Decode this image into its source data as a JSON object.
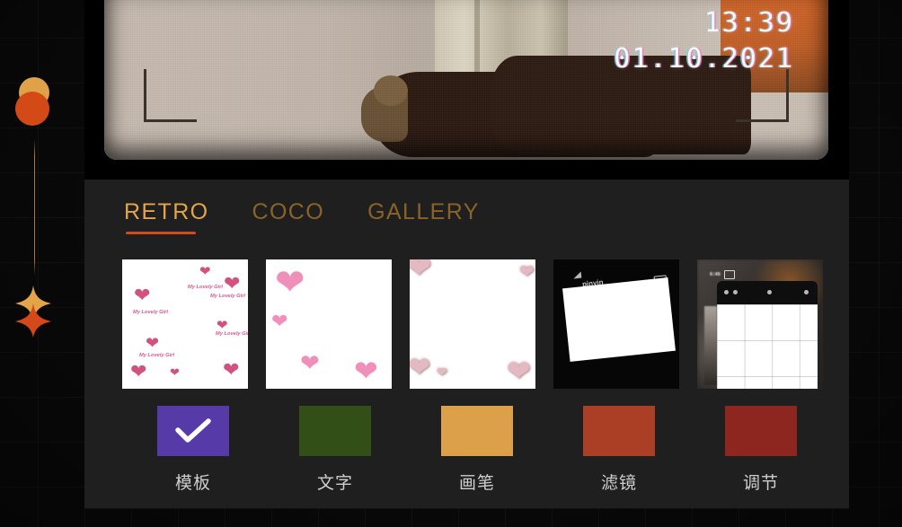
{
  "preview": {
    "timestamp_time": "13:39",
    "timestamp_date": "01.10.2021",
    "alt": "photo-preview"
  },
  "tabs": [
    {
      "label": "RETRO",
      "active": true
    },
    {
      "label": "COCO",
      "active": false
    },
    {
      "label": "GALLERY",
      "active": false
    }
  ],
  "templates": [
    {
      "name": "hearts-small-with-text",
      "caption_text": "My Lovely Girl"
    },
    {
      "name": "hearts-large-pink",
      "caption_text": ""
    },
    {
      "name": "hearts-glossy-3d",
      "caption_text": ""
    },
    {
      "name": "phone-screenshot-frame",
      "caption_text": "pinyin"
    },
    {
      "name": "photo-app-grid",
      "caption_text": ""
    }
  ],
  "tools": [
    {
      "label": "模板",
      "color": "#553aa8",
      "icon": "check-icon",
      "selected": true
    },
    {
      "label": "文字",
      "color": "#334f18",
      "icon": "",
      "selected": false
    },
    {
      "label": "画笔",
      "color": "#dba049",
      "icon": "",
      "selected": false
    },
    {
      "label": "滤镜",
      "color": "#ab3f26",
      "icon": "",
      "selected": false
    },
    {
      "label": "调节",
      "color": "#8e2620",
      "icon": "",
      "selected": false
    }
  ],
  "decor": {
    "circle_top_color": "#e0a249",
    "circle_bottom_color": "#d44a17",
    "star_top_color": "#e3a548",
    "star_bottom_color": "#d4491a",
    "accent_underline": "#cf4c21",
    "tab_active_color": "#e3a548",
    "tab_inactive_color": "#8a6327"
  }
}
